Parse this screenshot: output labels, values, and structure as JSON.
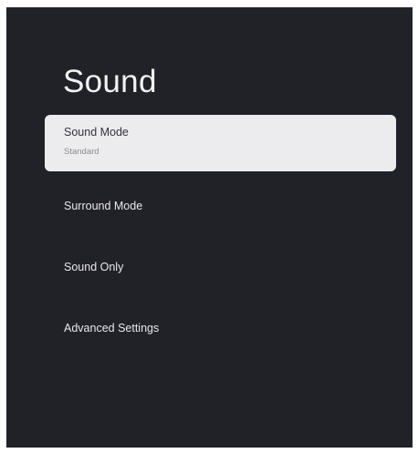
{
  "screen": {
    "title": "Sound"
  },
  "menu": {
    "items": [
      {
        "label": "Sound Mode",
        "value": "Standard",
        "selected": true
      },
      {
        "label": "Surround Mode"
      },
      {
        "label": "Sound Only"
      },
      {
        "label": "Advanced Settings"
      }
    ]
  },
  "colors": {
    "background": "#212128",
    "highlight": "#ececef",
    "text_light": "#e8e8ea",
    "text_dark": "#333338"
  }
}
